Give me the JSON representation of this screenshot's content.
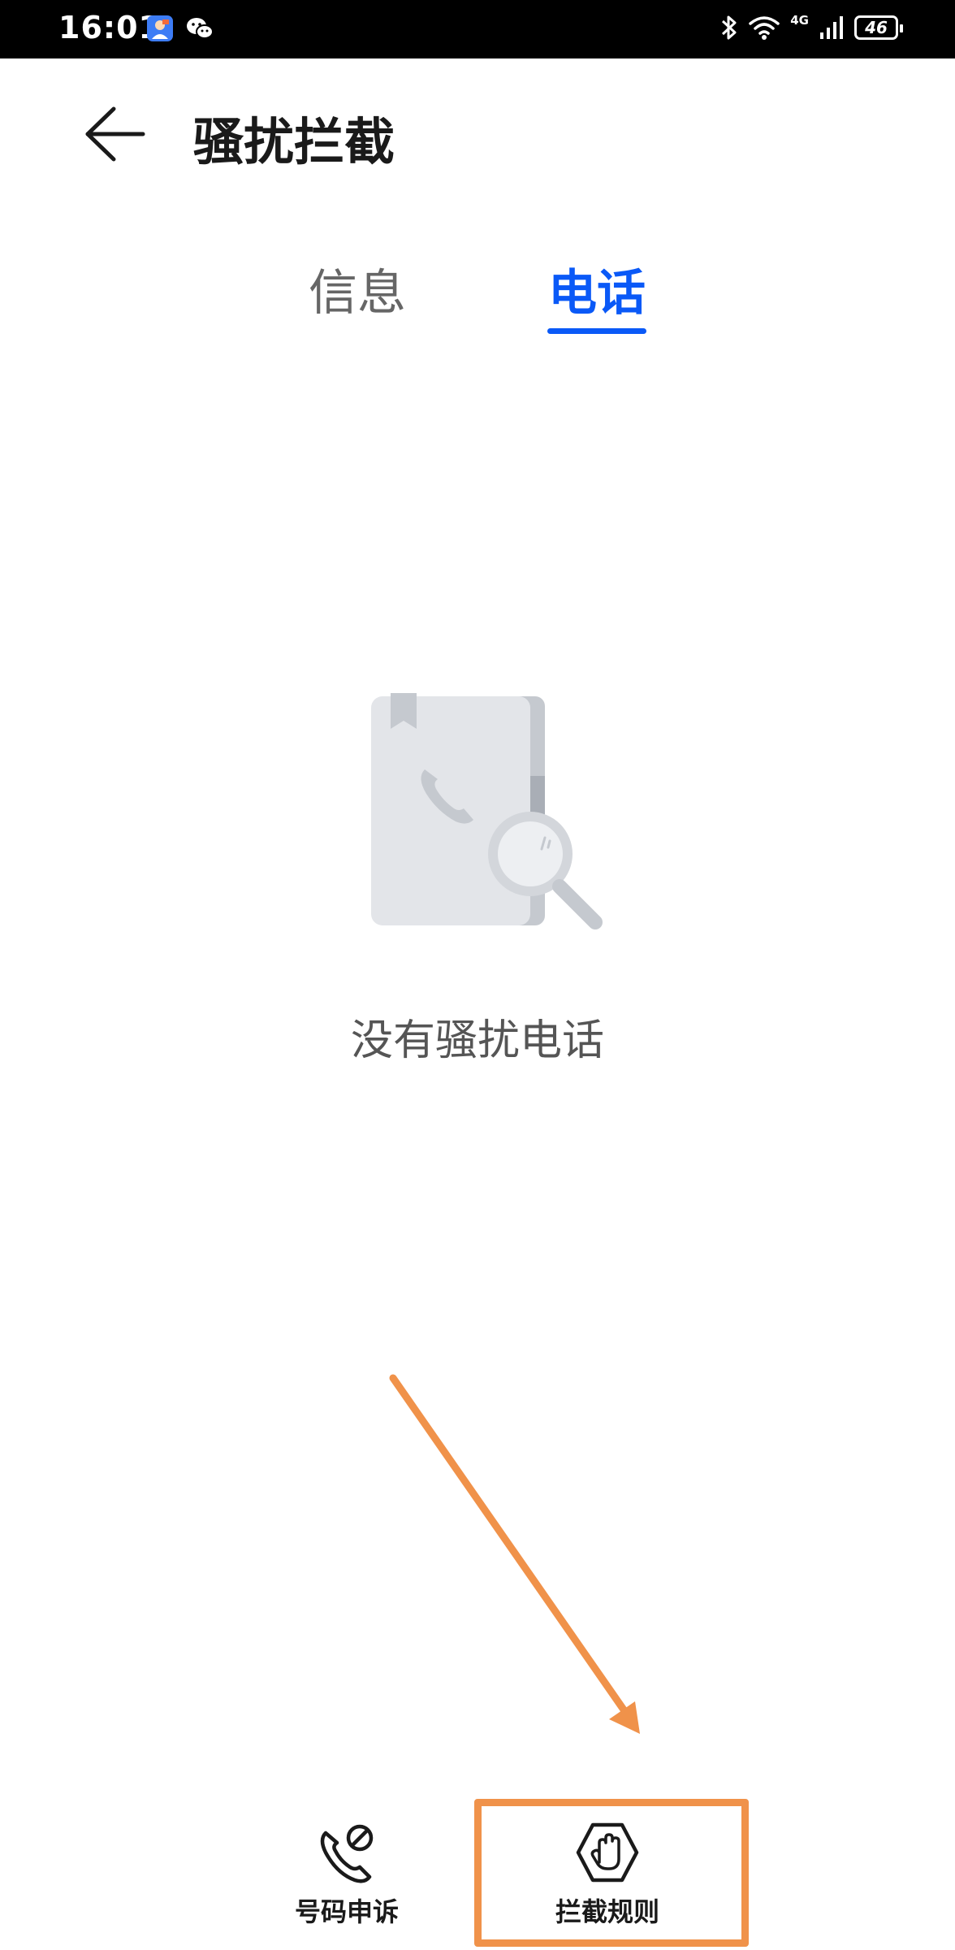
{
  "status_bar": {
    "time": "16:01",
    "network_type": "4G",
    "battery_level": "46",
    "icons": [
      "app-icon",
      "wechat-icon",
      "bluetooth-icon",
      "wifi-icon",
      "signal-icon",
      "battery-icon"
    ]
  },
  "header": {
    "title": "骚扰拦截",
    "back_icon": "back-arrow-icon"
  },
  "tabs": [
    {
      "label": "信息",
      "selected": false
    },
    {
      "label": "电话",
      "selected": true
    }
  ],
  "empty_state": {
    "icon": "phonebook-search-icon",
    "text": "没有骚扰电话"
  },
  "toolbar": {
    "appeal_label": "号码申诉",
    "appeal_icon": "phone-block-icon",
    "rules_label": "拦截规则",
    "rules_icon": "hand-stop-icon"
  },
  "colors": {
    "accent": "#0a59f7",
    "annotation": "#f0924a",
    "text_primary": "#1a1a1a",
    "text_secondary": "#666666"
  }
}
